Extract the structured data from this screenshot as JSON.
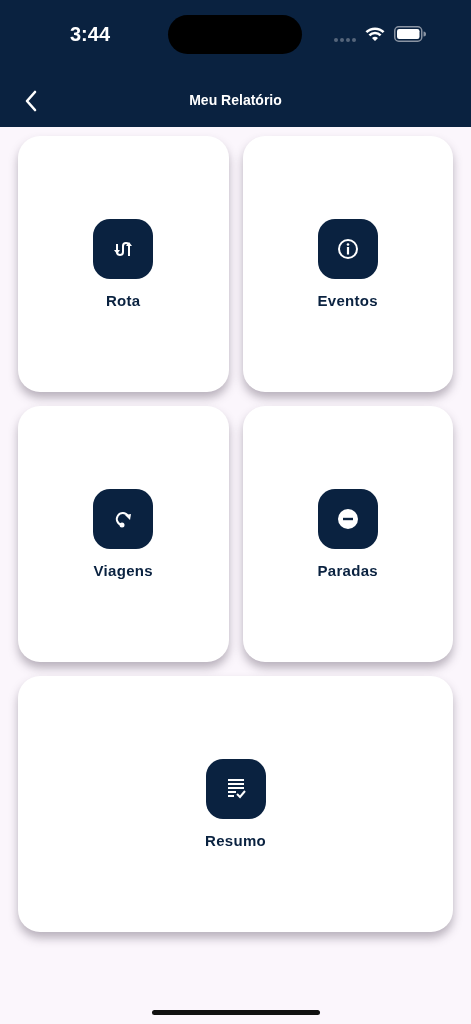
{
  "status_bar": {
    "time": "3:44"
  },
  "nav_bar": {
    "title": "Meu Relatório"
  },
  "tiles": [
    {
      "label": "Rota"
    },
    {
      "label": "Eventos"
    },
    {
      "label": "Viagens"
    },
    {
      "label": "Paradas"
    },
    {
      "label": "Resumo"
    }
  ]
}
